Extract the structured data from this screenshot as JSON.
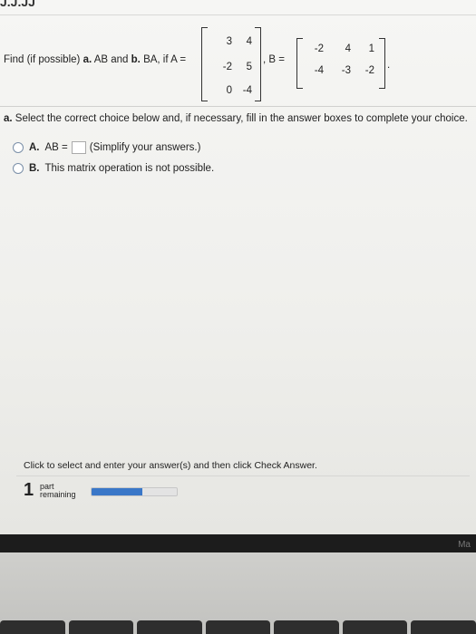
{
  "header": {
    "cut_title": "J.J.JJ"
  },
  "question": {
    "prompt_prefix": "Find (if possible) ",
    "part_a_bold": "a.",
    "part_a_text": " AB and ",
    "part_b_bold": "b.",
    "part_b_text": " BA, if A =",
    "matrix_A": [
      [
        "3",
        "4"
      ],
      [
        "-2",
        "5"
      ],
      [
        "0",
        "-4"
      ]
    ],
    "b_equals": ", B =",
    "matrix_B": [
      [
        "-2",
        "4",
        "1"
      ],
      [
        "-4",
        "-3",
        "-2"
      ]
    ],
    "end_punct": "."
  },
  "part_a": {
    "bold": "a.",
    "instruction": " Select the correct choice below and, if necessary, fill in the answer boxes to complete your choice."
  },
  "choices": [
    {
      "letter": "A.",
      "text_before": "AB =",
      "text_after": "(Simplify your answers.)"
    },
    {
      "letter": "B.",
      "text": "This matrix operation is not possible."
    }
  ],
  "footer": {
    "hint": "Click to select and enter your answer(s) and then click Check Answer.",
    "parts_count": "1",
    "parts_label_1": "part",
    "parts_label_2": "remaining",
    "progress_fraction": 0.6
  },
  "bezel": {
    "logo_fragment": "Ma"
  }
}
